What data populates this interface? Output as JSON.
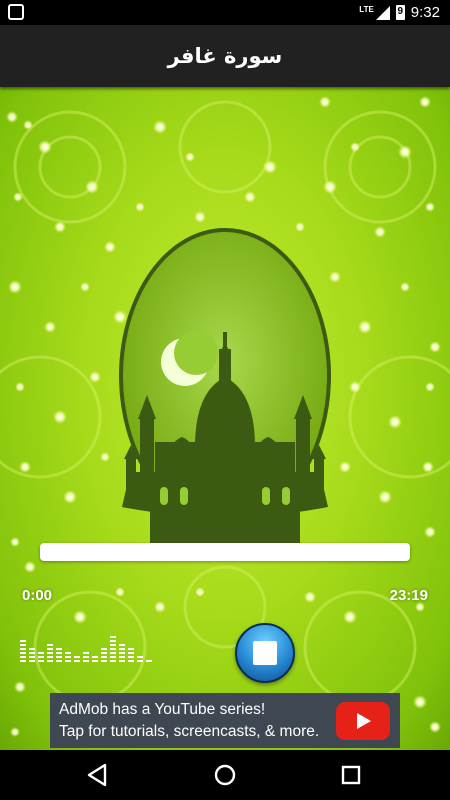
{
  "status_bar": {
    "time": "9:32",
    "network": "LTE",
    "battery_level": "9"
  },
  "app_bar": {
    "title": "سورة غافر"
  },
  "player": {
    "current_time": "0:00",
    "total_time": "23:19",
    "progress": 0
  },
  "ad": {
    "line1": "AdMob has a YouTube series!",
    "line2": "Tap for tutorials, screencasts, & more."
  },
  "colors": {
    "app_bar": "#212121",
    "background_green": "#a6da1a",
    "medallion": "#86bd1a",
    "silhouette": "#3d5a12",
    "ad_background": "#3f4752",
    "youtube_red": "#e62117"
  },
  "icons": {
    "notification": "notification-square-icon",
    "signal": "signal-icon",
    "battery": "battery-icon",
    "equalizer": "equalizer-icon",
    "stop": "stop-icon",
    "youtube": "youtube-play-icon",
    "back": "back-triangle-icon",
    "home": "home-circle-icon",
    "recents": "recents-square-icon"
  }
}
